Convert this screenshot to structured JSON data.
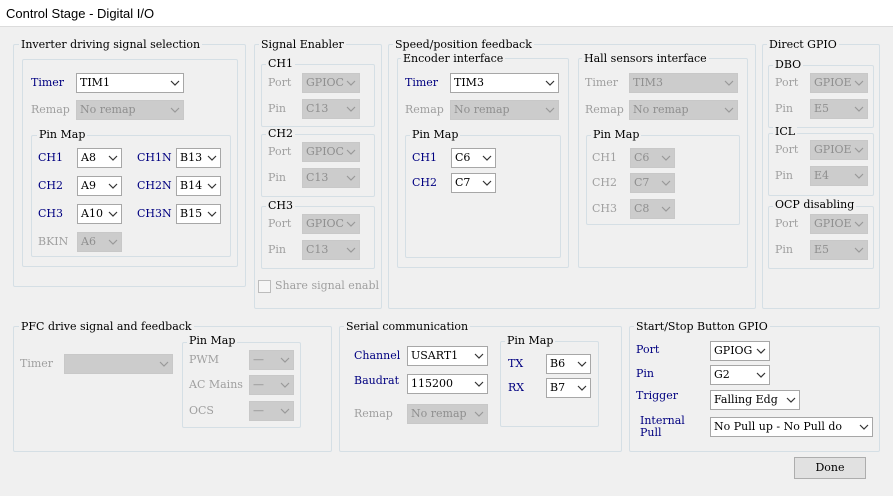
{
  "window": {
    "title": "Control Stage - Digital I/O"
  },
  "inverter": {
    "title": "Inverter driving signal selection",
    "timer_label": "Timer",
    "timer_value": "TIM1",
    "remap_label": "Remap",
    "remap_value": "No remap",
    "pinmap_title": "Pin Map",
    "ch1_label": "CH1",
    "ch1_value": "A8",
    "ch1n_label": "CH1N",
    "ch1n_value": "B13",
    "ch2_label": "CH2",
    "ch2_value": "A9",
    "ch2n_label": "CH2N",
    "ch2n_value": "B14",
    "ch3_label": "CH3",
    "ch3_value": "A10",
    "ch3n_label": "CH3N",
    "ch3n_value": "B15",
    "bkin_label": "BKIN",
    "bkin_value": "A6"
  },
  "signal_enabler": {
    "title": "Signal Enabler",
    "ch1": {
      "title": "CH1",
      "port_label": "Port",
      "port_value": "GPIOC",
      "pin_label": "Pin",
      "pin_value": "C13"
    },
    "ch2": {
      "title": "CH2",
      "port_label": "Port",
      "port_value": "GPIOC",
      "pin_label": "Pin",
      "pin_value": "C13"
    },
    "ch3": {
      "title": "CH3",
      "port_label": "Port",
      "port_value": "GPIOC",
      "pin_label": "Pin",
      "pin_value": "C13"
    },
    "share_label": "Share signal enabl"
  },
  "speed": {
    "title": "Speed/position feedback",
    "encoder": {
      "title": "Encoder interface",
      "timer_label": "Timer",
      "timer_value": "TIM3",
      "remap_label": "Remap",
      "remap_value": "No remap",
      "pinmap_title": "Pin Map",
      "ch1_label": "CH1",
      "ch1_value": "C6",
      "ch2_label": "CH2",
      "ch2_value": "C7"
    },
    "hall": {
      "title": "Hall sensors interface",
      "timer_label": "Timer",
      "timer_value": "TIM3",
      "remap_label": "Remap",
      "remap_value": "No remap",
      "pinmap_title": "Pin Map",
      "ch1_label": "CH1",
      "ch1_value": "C6",
      "ch2_label": "CH2",
      "ch2_value": "C7",
      "ch3_label": "CH3",
      "ch3_value": "C8"
    }
  },
  "direct_gpio": {
    "title": "Direct GPIO",
    "dbo": {
      "title": "DBO",
      "port_label": "Port",
      "port_value": "GPIOE",
      "pin_label": "Pin",
      "pin_value": "E5"
    },
    "icl": {
      "title": "ICL",
      "port_label": "Port",
      "port_value": "GPIOE",
      "pin_label": "Pin",
      "pin_value": "E4"
    },
    "ocp": {
      "title": "OCP disabling",
      "port_label": "Port",
      "port_value": "GPIOE",
      "pin_label": "Pin",
      "pin_value": "E5"
    }
  },
  "pfc": {
    "title": "PFC drive signal and feedback",
    "timer_label": "Timer",
    "timer_value": "",
    "pinmap_title": "Pin Map",
    "pwm_label": "PWM",
    "pwm_value": "—",
    "acmains_label": "AC Mains",
    "acmains_value": "—",
    "ocs_label": "OCS",
    "ocs_value": "—"
  },
  "serial": {
    "title": "Serial communication",
    "channel_label": "Channel",
    "channel_value": "USART1",
    "baudrate_label": "Baudrat",
    "baudrate_value": "115200",
    "remap_label": "Remap",
    "remap_value": "No remap",
    "pinmap_title": "Pin Map",
    "tx_label": "TX",
    "tx_value": "B6",
    "rx_label": "RX",
    "rx_value": "B7"
  },
  "startstop": {
    "title": "Start/Stop Button GPIO",
    "port_label": "Port",
    "port_value": "GPIOG",
    "pin_label": "Pin",
    "pin_value": "G2",
    "trigger_label": "Trigger",
    "trigger_value": "Falling Edg",
    "pull_label_1": "Internal",
    "pull_label_2": "Pull",
    "pull_value": "No Pull up - No Pull do"
  },
  "done_label": "Done",
  "colors": {
    "label_blue": "#000080",
    "disabled_text": "#a0a0a0",
    "disabled_combo": "#cccccc",
    "frame_border": "#d5dfe5"
  }
}
